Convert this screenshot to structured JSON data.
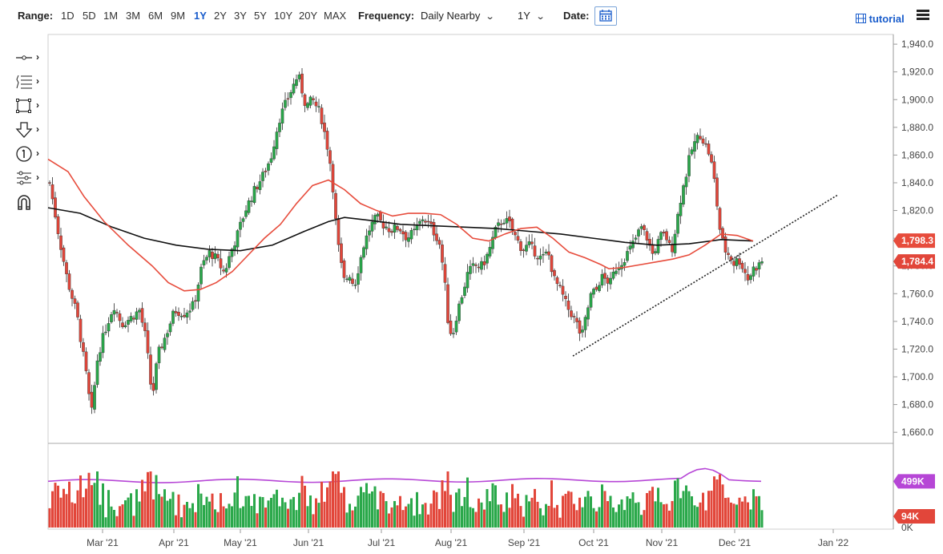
{
  "toolbar": {
    "range_label": "Range:",
    "ranges": [
      "1D",
      "5D",
      "1M",
      "3M",
      "6M",
      "9M",
      "1Y",
      "2Y",
      "3Y",
      "5Y",
      "10Y",
      "20Y",
      "MAX"
    ],
    "active_range": "1Y",
    "frequency_label": "Frequency:",
    "frequency_value": "Daily Nearby",
    "period_value": "1Y",
    "date_label": "Date:",
    "tutorial_label": "tutorial"
  },
  "tools": [
    "crosshair-tool",
    "fib-tool",
    "rectangle-tool",
    "arrow-tool",
    "text-number-tool",
    "measure-tool",
    "magnet-tool"
  ],
  "colors": {
    "up": "#2aa84a",
    "down": "#e2463a",
    "ma_short": "#e74c3c",
    "ma_long": "#111111",
    "volume_avg": "#b646d6",
    "label_upper": "#e2463a",
    "label_volume": "#b646d6"
  },
  "chart_data": {
    "type": "candlestick",
    "price_axis": {
      "ticks": [
        "1,940.0",
        "1,920.0",
        "1,900.0",
        "1,880.0",
        "1,860.0",
        "1,840.0",
        "1,820.0",
        "1,800.0",
        "1,780.0",
        "1,760.0",
        "1,740.0",
        "1,720.0",
        "1,700.0",
        "1,680.0",
        "1,660.0"
      ],
      "ylim": [
        1652,
        1947
      ]
    },
    "x_axis": {
      "ticks": [
        "Mar '21",
        "Apr '21",
        "May '21",
        "Jun '21",
        "Jul '21",
        "Aug '21",
        "Sep '21",
        "Oct '21",
        "Nov '21",
        "Dec '21",
        "Jan '22"
      ]
    },
    "price_labels": [
      "1,798.3",
      "1,784.4"
    ],
    "volume_labels": [
      "499K",
      "94K",
      "0K"
    ],
    "price_path": [
      [
        0,
        1840
      ],
      [
        12,
        1800
      ],
      [
        22,
        1770
      ],
      [
        34,
        1745
      ],
      [
        46,
        1700
      ],
      [
        52,
        1672
      ],
      [
        60,
        1715
      ],
      [
        70,
        1735
      ],
      [
        80,
        1752
      ],
      [
        90,
        1738
      ],
      [
        100,
        1742
      ],
      [
        112,
        1748
      ],
      [
        120,
        1728
      ],
      [
        128,
        1684
      ],
      [
        135,
        1716
      ],
      [
        145,
        1730
      ],
      [
        156,
        1748
      ],
      [
        168,
        1746
      ],
      [
        180,
        1752
      ],
      [
        190,
        1780
      ],
      [
        200,
        1790
      ],
      [
        208,
        1785
      ],
      [
        218,
        1775
      ],
      [
        226,
        1790
      ],
      [
        234,
        1802
      ],
      [
        244,
        1820
      ],
      [
        256,
        1835
      ],
      [
        266,
        1845
      ],
      [
        276,
        1858
      ],
      [
        286,
        1885
      ],
      [
        298,
        1902
      ],
      [
        310,
        1918
      ],
      [
        320,
        1895
      ],
      [
        328,
        1900
      ],
      [
        338,
        1890
      ],
      [
        346,
        1868
      ],
      [
        352,
        1848
      ],
      [
        356,
        1818
      ],
      [
        360,
        1795
      ],
      [
        364,
        1780
      ],
      [
        368,
        1768
      ],
      [
        374,
        1775
      ],
      [
        380,
        1765
      ],
      [
        386,
        1780
      ],
      [
        392,
        1795
      ],
      [
        400,
        1808
      ],
      [
        408,
        1815
      ],
      [
        416,
        1810
      ],
      [
        426,
        1806
      ],
      [
        436,
        1808
      ],
      [
        446,
        1800
      ],
      [
        456,
        1805
      ],
      [
        466,
        1815
      ],
      [
        476,
        1808
      ],
      [
        486,
        1798
      ],
      [
        492,
        1775
      ],
      [
        498,
        1735
      ],
      [
        503,
        1730
      ],
      [
        508,
        1745
      ],
      [
        515,
        1760
      ],
      [
        522,
        1775
      ],
      [
        530,
        1780
      ],
      [
        540,
        1780
      ],
      [
        548,
        1790
      ],
      [
        556,
        1805
      ],
      [
        566,
        1814
      ],
      [
        574,
        1810
      ],
      [
        582,
        1800
      ],
      [
        590,
        1792
      ],
      [
        598,
        1795
      ],
      [
        606,
        1790
      ],
      [
        614,
        1785
      ],
      [
        622,
        1790
      ],
      [
        630,
        1770
      ],
      [
        638,
        1762
      ],
      [
        646,
        1750
      ],
      [
        652,
        1745
      ],
      [
        658,
        1738
      ],
      [
        664,
        1728
      ],
      [
        670,
        1745
      ],
      [
        676,
        1760
      ],
      [
        682,
        1762
      ],
      [
        688,
        1772
      ],
      [
        694,
        1770
      ],
      [
        700,
        1768
      ],
      [
        706,
        1778
      ],
      [
        714,
        1783
      ],
      [
        722,
        1790
      ],
      [
        730,
        1798
      ],
      [
        738,
        1808
      ],
      [
        746,
        1800
      ],
      [
        752,
        1788
      ],
      [
        758,
        1795
      ],
      [
        764,
        1803
      ],
      [
        770,
        1800
      ],
      [
        776,
        1790
      ],
      [
        782,
        1810
      ],
      [
        788,
        1830
      ],
      [
        794,
        1845
      ],
      [
        800,
        1862
      ],
      [
        806,
        1870
      ],
      [
        812,
        1875
      ],
      [
        818,
        1868
      ],
      [
        824,
        1860
      ],
      [
        830,
        1840
      ],
      [
        836,
        1808
      ],
      [
        842,
        1792
      ],
      [
        848,
        1788
      ],
      [
        854,
        1782
      ],
      [
        860,
        1785
      ],
      [
        866,
        1778
      ],
      [
        872,
        1770
      ],
      [
        878,
        1778
      ],
      [
        884,
        1780
      ],
      [
        890,
        1784
      ]
    ],
    "ma_short_path": [
      [
        0,
        1857
      ],
      [
        25,
        1848
      ],
      [
        45,
        1830
      ],
      [
        70,
        1812
      ],
      [
        100,
        1795
      ],
      [
        130,
        1780
      ],
      [
        150,
        1768
      ],
      [
        170,
        1762
      ],
      [
        190,
        1763
      ],
      [
        210,
        1768
      ],
      [
        230,
        1776
      ],
      [
        250,
        1788
      ],
      [
        270,
        1800
      ],
      [
        290,
        1810
      ],
      [
        310,
        1825
      ],
      [
        330,
        1838
      ],
      [
        350,
        1842
      ],
      [
        370,
        1835
      ],
      [
        390,
        1825
      ],
      [
        410,
        1820
      ],
      [
        430,
        1816
      ],
      [
        450,
        1818
      ],
      [
        470,
        1818
      ],
      [
        490,
        1817
      ],
      [
        510,
        1810
      ],
      [
        530,
        1800
      ],
      [
        550,
        1798
      ],
      [
        570,
        1803
      ],
      [
        590,
        1807
      ],
      [
        610,
        1808
      ],
      [
        630,
        1800
      ],
      [
        650,
        1790
      ],
      [
        670,
        1786
      ],
      [
        690,
        1781
      ],
      [
        700,
        1778
      ],
      [
        720,
        1779
      ],
      [
        740,
        1781
      ],
      [
        760,
        1783
      ],
      [
        780,
        1785
      ],
      [
        800,
        1788
      ],
      [
        820,
        1795
      ],
      [
        840,
        1803
      ],
      [
        860,
        1802
      ],
      [
        880,
        1798
      ]
    ],
    "ma_long_path": [
      [
        0,
        1822
      ],
      [
        40,
        1818
      ],
      [
        80,
        1808
      ],
      [
        120,
        1800
      ],
      [
        160,
        1795
      ],
      [
        200,
        1792
      ],
      [
        240,
        1791
      ],
      [
        280,
        1795
      ],
      [
        320,
        1805
      ],
      [
        350,
        1812
      ],
      [
        370,
        1815
      ],
      [
        400,
        1813
      ],
      [
        440,
        1810
      ],
      [
        480,
        1809
      ],
      [
        520,
        1808
      ],
      [
        560,
        1807
      ],
      [
        600,
        1805
      ],
      [
        640,
        1803
      ],
      [
        680,
        1800
      ],
      [
        720,
        1797
      ],
      [
        760,
        1795
      ],
      [
        800,
        1796
      ],
      [
        840,
        1799
      ],
      [
        880,
        1798
      ]
    ],
    "trendline": {
      "from": [
        655,
        1715
      ],
      "to": [
        985,
        1831
      ]
    },
    "volume_avg_level": [
      0.56,
      0.58
    ],
    "series": [
      {
        "name": "",
        "kind": "candles"
      },
      {
        "name": "",
        "kind": "ma_short"
      },
      {
        "name": "",
        "kind": "ma_long"
      },
      {
        "name": "",
        "kind": "volume"
      }
    ]
  }
}
